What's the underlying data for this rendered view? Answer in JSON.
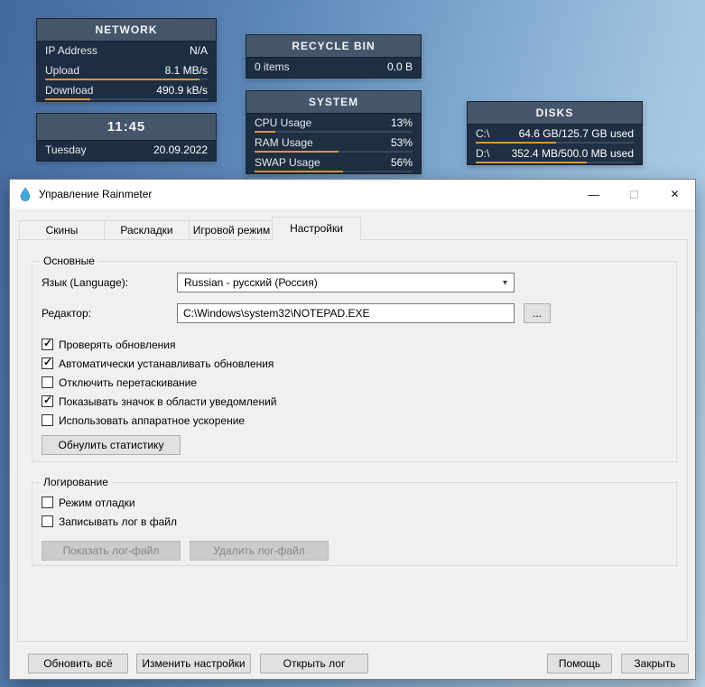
{
  "widgets": {
    "network": {
      "title": "NETWORK",
      "rows": [
        {
          "label": "IP Address",
          "value": "N/A"
        },
        {
          "label": "Upload",
          "value": "8.1 MB/s",
          "pct": 95
        },
        {
          "label": "Download",
          "value": "490.9 kB/s",
          "pct": 28
        }
      ]
    },
    "clock": {
      "time": "11:45",
      "day": "Tuesday",
      "date": "20.09.2022"
    },
    "recycle_bin": {
      "title": "RECYCLE BIN",
      "items": "0 items",
      "size": "0.0 B"
    },
    "system": {
      "title": "SYSTEM",
      "rows": [
        {
          "label": "CPU Usage",
          "value": "13%",
          "pct": 13
        },
        {
          "label": "RAM Usage",
          "value": "53%",
          "pct": 53
        },
        {
          "label": "SWAP Usage",
          "value": "56%",
          "pct": 56
        }
      ]
    },
    "disks": {
      "title": "DISKS",
      "rows": [
        {
          "label": "C:\\",
          "value": "64.6 GB/125.7 GB used",
          "pct": 51
        },
        {
          "label": "D:\\",
          "value": "352.4 MB/500.0 MB used",
          "pct": 70
        }
      ]
    }
  },
  "window": {
    "title": "Управление Rainmeter",
    "icons": {
      "minimize": "—",
      "close": "✕"
    },
    "tabs": [
      {
        "label": "Скины"
      },
      {
        "label": "Раскладки"
      },
      {
        "label": "Игровой режим"
      },
      {
        "label": "Настройки"
      }
    ],
    "general": {
      "title": "Основные",
      "language_label": "Язык (Language):",
      "language_value": "Russian - русский (Россия)",
      "combo_chevron": "▾",
      "editor_label": "Редактор:",
      "editor_value": "C:\\Windows\\system32\\NOTEPAD.EXE",
      "browse_label": "...",
      "checkboxes": [
        {
          "label": "Проверять обновления",
          "checked": true
        },
        {
          "label": "Автоматически устанавливать обновления",
          "checked": true
        },
        {
          "label": "Отключить перетаскивание",
          "checked": false
        },
        {
          "label": "Показывать значок в области уведомлений",
          "checked": true
        },
        {
          "label": "Использовать аппаратное ускорение",
          "checked": false
        }
      ],
      "reset_button": "Обнулить статистику"
    },
    "logging": {
      "title": "Логирование",
      "checkboxes": [
        {
          "label": "Режим отладки",
          "checked": false
        },
        {
          "label": "Записывать лог в файл",
          "checked": false
        }
      ],
      "show_log_button": "Показать лог-файл",
      "delete_log_button": "Удалить лог-файл"
    },
    "footer": {
      "refresh_all": "Обновить всё",
      "edit_settings": "Изменить настройки",
      "open_log": "Открыть лог",
      "help": "Помощь",
      "close": "Закрыть"
    }
  }
}
